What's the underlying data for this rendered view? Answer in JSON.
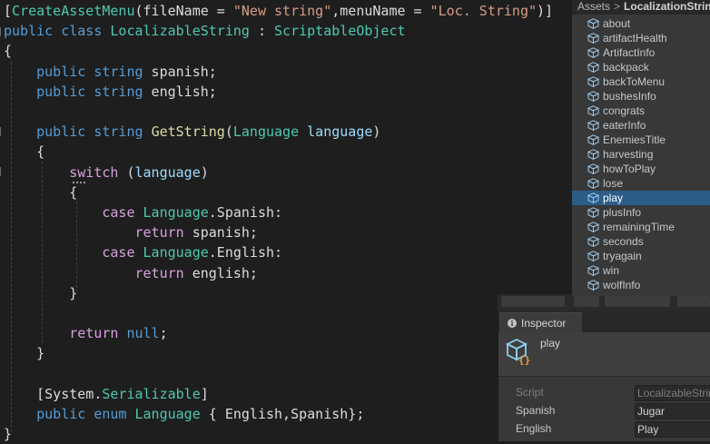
{
  "editor": {
    "lines": [
      {
        "tokens": [
          {
            "t": "[",
            "c": "pl"
          },
          {
            "t": "CreateAssetMenu",
            "c": "typ"
          },
          {
            "t": "(fileName = ",
            "c": "pl"
          },
          {
            "t": "\"New string\"",
            "c": "str"
          },
          {
            "t": ",menuName = ",
            "c": "pl"
          },
          {
            "t": "\"Loc. String\"",
            "c": "str"
          },
          {
            "t": ")]",
            "c": "pl"
          }
        ]
      },
      {
        "tokens": [
          {
            "t": "public",
            "c": "kw"
          },
          {
            "t": " ",
            "c": "pl"
          },
          {
            "t": "class",
            "c": "kw"
          },
          {
            "t": " ",
            "c": "pl"
          },
          {
            "t": "LocalizableString",
            "c": "typ"
          },
          {
            "t": " : ",
            "c": "pl"
          },
          {
            "t": "ScriptableObject",
            "c": "typ"
          }
        ]
      },
      {
        "tokens": [
          {
            "t": "{",
            "c": "pl"
          }
        ]
      },
      {
        "tokens": [
          {
            "t": "    ",
            "c": "pl"
          },
          {
            "t": "public",
            "c": "kw"
          },
          {
            "t": " ",
            "c": "pl"
          },
          {
            "t": "string",
            "c": "kw"
          },
          {
            "t": " spanish;",
            "c": "pl"
          }
        ]
      },
      {
        "tokens": [
          {
            "t": "    ",
            "c": "pl"
          },
          {
            "t": "public",
            "c": "kw"
          },
          {
            "t": " ",
            "c": "pl"
          },
          {
            "t": "string",
            "c": "kw"
          },
          {
            "t": " english;",
            "c": "pl"
          }
        ]
      },
      {
        "tokens": []
      },
      {
        "tokens": [
          {
            "t": "    ",
            "c": "pl"
          },
          {
            "t": "public",
            "c": "kw"
          },
          {
            "t": " ",
            "c": "pl"
          },
          {
            "t": "string",
            "c": "kw"
          },
          {
            "t": " ",
            "c": "pl"
          },
          {
            "t": "GetString",
            "c": "fn"
          },
          {
            "t": "(",
            "c": "pl"
          },
          {
            "t": "Language",
            "c": "typ"
          },
          {
            "t": " ",
            "c": "pl"
          },
          {
            "t": "language",
            "c": "prm"
          },
          {
            "t": ")",
            "c": "pl"
          }
        ]
      },
      {
        "tokens": [
          {
            "t": "    {",
            "c": "pl"
          }
        ]
      },
      {
        "tokens": [
          {
            "t": "        ",
            "c": "pl"
          },
          {
            "t": "switch",
            "c": "ctl"
          },
          {
            "t": " (",
            "c": "pl"
          },
          {
            "t": "language",
            "c": "prm"
          },
          {
            "t": ")",
            "c": "pl"
          }
        ]
      },
      {
        "tokens": [
          {
            "t": "        {",
            "c": "pl"
          }
        ]
      },
      {
        "tokens": [
          {
            "t": "            ",
            "c": "pl"
          },
          {
            "t": "case",
            "c": "ctl"
          },
          {
            "t": " ",
            "c": "pl"
          },
          {
            "t": "Language",
            "c": "typ"
          },
          {
            "t": ".Spanish:",
            "c": "pl"
          }
        ]
      },
      {
        "tokens": [
          {
            "t": "                ",
            "c": "pl"
          },
          {
            "t": "return",
            "c": "ctl"
          },
          {
            "t": " spanish;",
            "c": "pl"
          }
        ]
      },
      {
        "tokens": [
          {
            "t": "            ",
            "c": "pl"
          },
          {
            "t": "case",
            "c": "ctl"
          },
          {
            "t": " ",
            "c": "pl"
          },
          {
            "t": "Language",
            "c": "typ"
          },
          {
            "t": ".English:",
            "c": "pl"
          }
        ]
      },
      {
        "tokens": [
          {
            "t": "                ",
            "c": "pl"
          },
          {
            "t": "return",
            "c": "ctl"
          },
          {
            "t": " english;",
            "c": "pl"
          }
        ]
      },
      {
        "tokens": [
          {
            "t": "        }",
            "c": "pl"
          }
        ]
      },
      {
        "tokens": []
      },
      {
        "tokens": [
          {
            "t": "        ",
            "c": "pl"
          },
          {
            "t": "return",
            "c": "ctl"
          },
          {
            "t": " ",
            "c": "pl"
          },
          {
            "t": "null",
            "c": "kw"
          },
          {
            "t": ";",
            "c": "pl"
          }
        ]
      },
      {
        "tokens": [
          {
            "t": "    }",
            "c": "pl"
          }
        ]
      },
      {
        "tokens": []
      },
      {
        "tokens": [
          {
            "t": "    [",
            "c": "pl"
          },
          {
            "t": "System",
            "c": "pl"
          },
          {
            "t": ".",
            "c": "pl"
          },
          {
            "t": "Serializable",
            "c": "typ"
          },
          {
            "t": "]",
            "c": "pl"
          }
        ]
      },
      {
        "tokens": [
          {
            "t": "    ",
            "c": "pl"
          },
          {
            "t": "public",
            "c": "kw"
          },
          {
            "t": " ",
            "c": "pl"
          },
          {
            "t": "enum",
            "c": "kw"
          },
          {
            "t": " ",
            "c": "pl"
          },
          {
            "t": "Language",
            "c": "typ"
          },
          {
            "t": " { English,Spanish};",
            "c": "pl"
          }
        ]
      },
      {
        "tokens": [
          {
            "t": "}",
            "c": "pl"
          }
        ]
      }
    ]
  },
  "project": {
    "breadcrumb": {
      "root": "Assets",
      "separator": ">",
      "folder": "LocalizationStrings"
    },
    "asset_icon": "scriptable-object-icon",
    "assets": [
      "about",
      "artifactHealth",
      "ArtifactInfo",
      "backpack",
      "backToMenu",
      "bushesInfo",
      "congrats",
      "eaterInfo",
      "EnemiesTitle",
      "harvesting",
      "howToPlay",
      "lose",
      "play",
      "plusInfo",
      "remainingTime",
      "seconds",
      "tryagain",
      "win",
      "wolfInfo"
    ],
    "selected": "play"
  },
  "inspector": {
    "tab_label": "Inspector",
    "tab_icon": "info-icon",
    "object_name": "play",
    "object_icon": "scriptable-object-icon",
    "properties": [
      {
        "name": "Script",
        "value": "LocalizableString",
        "disabled": true
      },
      {
        "name": "Spanish",
        "value": "Jugar",
        "disabled": false
      },
      {
        "name": "English",
        "value": "Play",
        "disabled": false
      }
    ]
  },
  "colors": {
    "keyword": "#569cd6",
    "control": "#d8a0df",
    "type": "#4ec9b0",
    "string": "#d69d85",
    "method": "#dcdcaa",
    "parameter": "#9cdcfe",
    "plain": "#dcdcdc",
    "selection": "#2c5d87"
  }
}
